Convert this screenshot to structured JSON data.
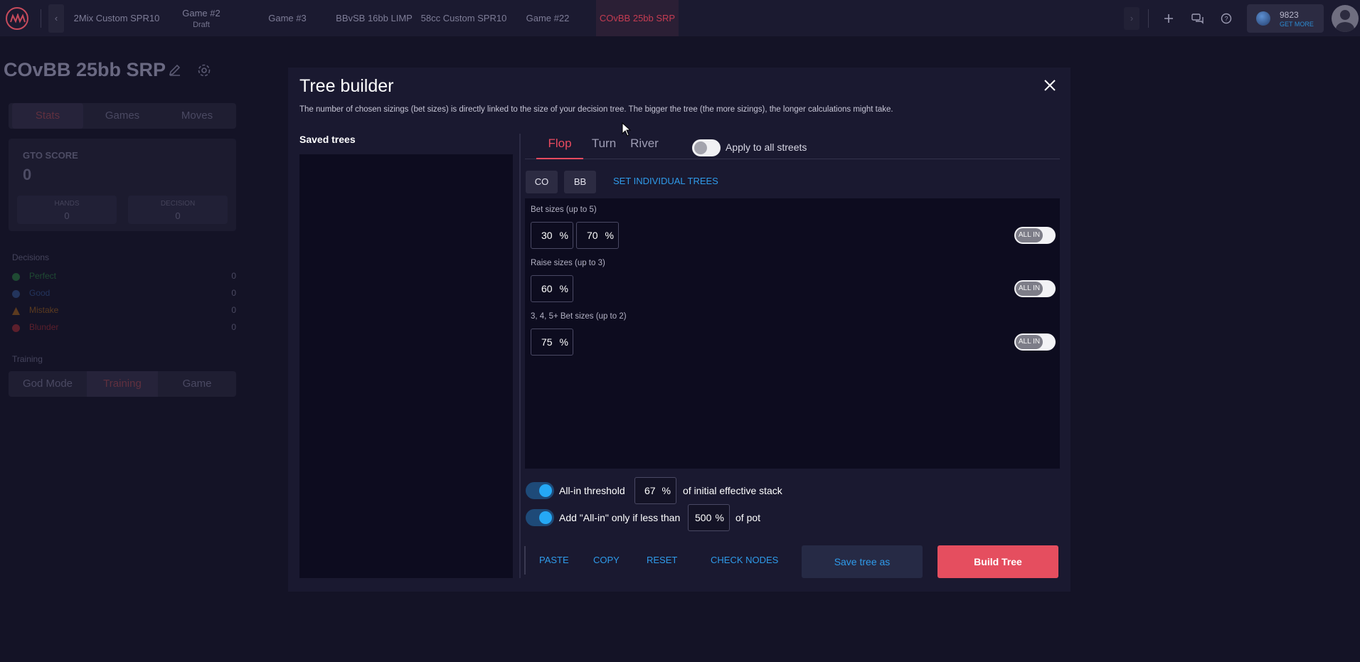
{
  "topbar": {
    "tabs": [
      {
        "label": "2Mix Custom SPR10",
        "sub": ""
      },
      {
        "label": "Game #2",
        "sub": "Draft"
      },
      {
        "label": "Game #3",
        "sub": ""
      },
      {
        "label": "BBvSB 16bb LIMP",
        "sub": ""
      },
      {
        "label": "58cc Custom SPR10",
        "sub": ""
      },
      {
        "label": "Game #22",
        "sub": ""
      },
      {
        "label": "COvBB 25bb SRP",
        "sub": ""
      }
    ],
    "credits": {
      "amount": "9823",
      "label": "GET MORE"
    },
    "accent_color": "#c43c52"
  },
  "page": {
    "title": "COvBB 25bb SRP",
    "tabs": [
      "Stats",
      "Games",
      "Moves"
    ],
    "gto_score_label": "GTO SCORE",
    "gto_score_value": "0",
    "hands_label": "HANDS",
    "hands_value": "0",
    "decision_label": "DECISION",
    "decision_value": "0",
    "decisions_title": "Decisions",
    "decisions": [
      {
        "label": "Perfect",
        "count": "0",
        "color": "#1f4a33"
      },
      {
        "label": "Good",
        "count": "0",
        "color": "#23345c"
      },
      {
        "label": "Mistake",
        "count": "0",
        "color": "#5c3b1f"
      },
      {
        "label": "Blunder",
        "count": "0",
        "color": "#5c1f2c"
      }
    ],
    "training_title": "Training",
    "modes": [
      "God Mode",
      "Training",
      "Game"
    ]
  },
  "modal": {
    "title": "Tree builder",
    "description": "The number of chosen sizings (bet sizes) is directly linked to the size of your decision tree. The bigger the tree (the more sizings), the longer calculations might take.",
    "saved_trees_label": "Saved trees",
    "streets": [
      "Flop",
      "Turn",
      "River"
    ],
    "active_street": "Flop",
    "apply_all_label": "Apply to all streets",
    "positions": [
      "CO",
      "BB"
    ],
    "set_individual_label": "SET INDIVIDUAL TREES",
    "bet_sizes": {
      "label": "Bet sizes (up to 5)",
      "values": [
        "30",
        "70"
      ]
    },
    "raise_sizes": {
      "label": "Raise sizes (up to 3)",
      "values": [
        "60"
      ]
    },
    "multi_bet_sizes": {
      "label": "3, 4, 5+ Bet sizes (up to 2)",
      "values": [
        "75"
      ]
    },
    "percent_symbol": "%",
    "allin_label": "ALL IN",
    "allin_threshold": {
      "label": "All-in threshold",
      "value": "67",
      "suffix": "of initial effective stack"
    },
    "add_allin": {
      "label": "Add \"All-in\" only if less than",
      "value": "500",
      "suffix": "of pot"
    },
    "actions": {
      "paste": "PASTE",
      "copy": "COPY",
      "reset": "RESET",
      "check_nodes": "CHECK NODES",
      "save_as": "Save tree as",
      "build": "Build Tree"
    },
    "accent_color": "#e54e5f",
    "link_color": "#2f9bea"
  }
}
